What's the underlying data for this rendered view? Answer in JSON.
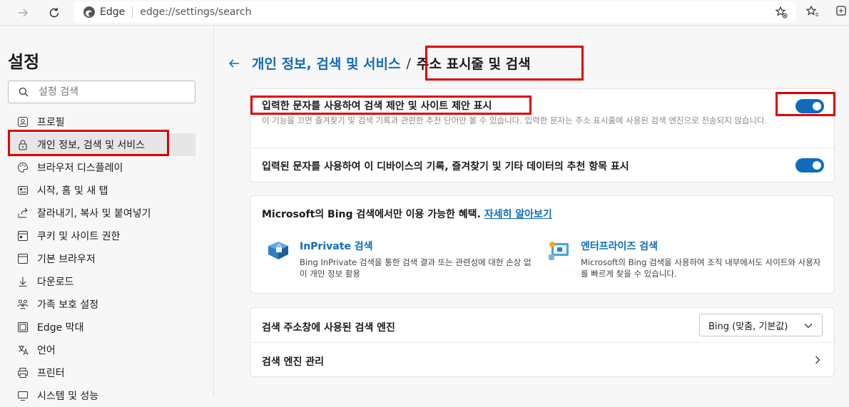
{
  "browser": {
    "brand": "Edge",
    "url": "edge://settings/search"
  },
  "sidebar": {
    "title": "설정",
    "search_placeholder": "설정 검색",
    "items": [
      {
        "label": "프로필",
        "icon": "profile-icon"
      },
      {
        "label": "개인 정보, 검색 및 서비스",
        "icon": "lock-icon",
        "active": true
      },
      {
        "label": "브라우저 디스플레이",
        "icon": "palette-icon"
      },
      {
        "label": "시작, 홈 및 새 탭",
        "icon": "home-tab-icon"
      },
      {
        "label": "잘라내기, 복사 및 붙여넣기",
        "icon": "share-icon"
      },
      {
        "label": "쿠키 및 사이트 권한",
        "icon": "cookie-icon"
      },
      {
        "label": "기본 브라우저",
        "icon": "browser-icon"
      },
      {
        "label": "다운로드",
        "icon": "download-icon"
      },
      {
        "label": "가족 보호 설정",
        "icon": "family-icon"
      },
      {
        "label": "Edge 막대",
        "icon": "edge-bar-icon"
      },
      {
        "label": "언어",
        "icon": "language-icon"
      },
      {
        "label": "프린터",
        "icon": "printer-icon"
      },
      {
        "label": "시스템 및 성능",
        "icon": "system-icon"
      }
    ]
  },
  "header": {
    "parent": "개인 정보, 검색 및 서비스",
    "separator": "/",
    "current": "주소 표시줄 및 검색"
  },
  "suggestions_card": {
    "row1": {
      "title": "입력한 문자를 사용하여 검색 제안 및 사이트 제안 표시",
      "desc": "이 기능을 끄면 즐겨찾기 및 검색 기록과 관련한 추천 단어만 볼 수 있습니다. 입력한 문자는 주소 표시줄에 사용된 검색 엔진으로 전송되지 않습니다.",
      "enabled": true
    },
    "row2": {
      "title": "입력된 문자를 사용하여 이 디바이스의 기록, 즐겨찾기 및 기타 데이터의 추천 항목 표시",
      "enabled": true
    }
  },
  "bing_card": {
    "intro": "Microsoft의 Bing 검색에서만 이용 가능한 혜택.",
    "link": "자세히 알아보기",
    "features": [
      {
        "title": "InPrivate 검색",
        "desc": "Bing InPrivate 검색을 통한 검색 결과 또는 관련성에 대한 손상 없이 개인 정보 활용",
        "icon": "inprivate-search-icon"
      },
      {
        "title": "엔터프라이즈 검색",
        "desc": "Microsoft의 Bing 검색을 사용하여 조직 내부에서도 사이트와 사용자를 빠르게 찾을 수 있습니다.",
        "icon": "enterprise-search-icon"
      }
    ]
  },
  "engine_card": {
    "engine_label": "검색 주소창에 사용된 검색 엔진",
    "engine_value": "Bing (맞춤, 기본값)",
    "manage_label": "검색 엔진 관리"
  },
  "colors": {
    "accent": "#0f6cbd",
    "highlight": "#e00000"
  }
}
